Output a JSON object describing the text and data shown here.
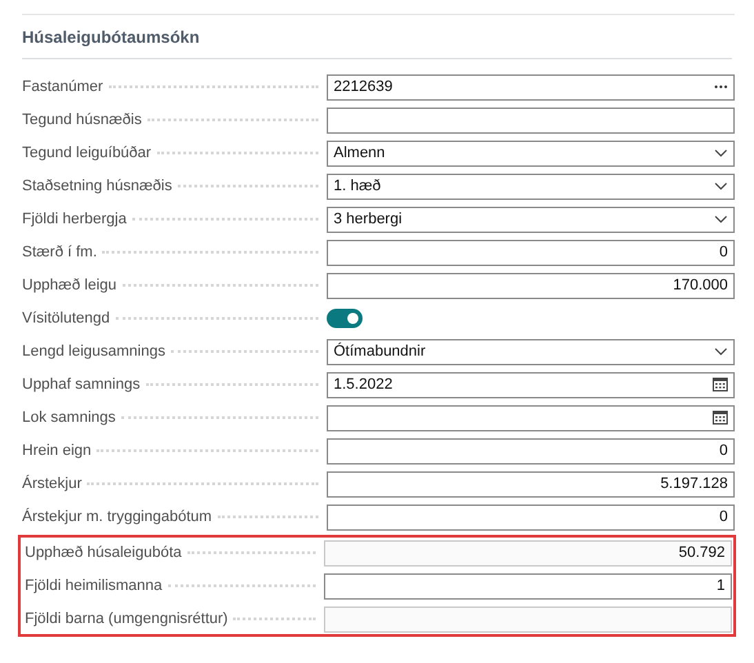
{
  "section": {
    "title": "Húsaleigubótaumsókn"
  },
  "fields": [
    {
      "label": "Fastanúmer",
      "kind": "lookup",
      "value": "2212639",
      "disabled": false
    },
    {
      "label": "Tegund húsnæðis",
      "kind": "text",
      "disabled": false
    },
    {
      "label": "Tegund leiguíbúðar",
      "kind": "select",
      "value": "Almenn",
      "disabled": false
    },
    {
      "label": "Staðsetning húsnæðis",
      "kind": "select",
      "value": "1. hæð",
      "disabled": false
    },
    {
      "label": "Fjöldi herbergja",
      "kind": "select",
      "value": "3 herbergi",
      "disabled": false
    },
    {
      "label": "Stærð í fm.",
      "kind": "number",
      "value": "0",
      "disabled": false
    },
    {
      "label": "Upphæð leigu",
      "kind": "number",
      "value": "170.000",
      "disabled": false
    },
    {
      "label": "Vísitölutengd",
      "kind": "toggle",
      "on": true,
      "disabled": false
    },
    {
      "label": "Lengd leigusamnings",
      "kind": "select",
      "value": "Ótímabundnir",
      "disabled": false
    },
    {
      "label": "Upphaf samnings",
      "kind": "date",
      "value": "1.5.2022",
      "disabled": false
    },
    {
      "label": "Lok samnings",
      "kind": "date",
      "disabled": false
    },
    {
      "label": "Hrein eign",
      "kind": "number",
      "value": "0",
      "disabled": false
    },
    {
      "label": "Árstekjur",
      "kind": "number",
      "value": "5.197.128",
      "disabled": false
    },
    {
      "label": "Árstekjur m. tryggingabótum",
      "kind": "number",
      "value": "0",
      "disabled": false
    }
  ],
  "highlighted_fields": [
    {
      "label": "Upphæð húsaleigubóta",
      "kind": "number",
      "value": "50.792",
      "disabled": true
    },
    {
      "label": "Fjöldi heimilismanna",
      "kind": "number",
      "value": "1",
      "disabled": false
    },
    {
      "label": "Fjöldi barna (umgengnisréttur)",
      "kind": "number",
      "disabled": true
    }
  ]
}
